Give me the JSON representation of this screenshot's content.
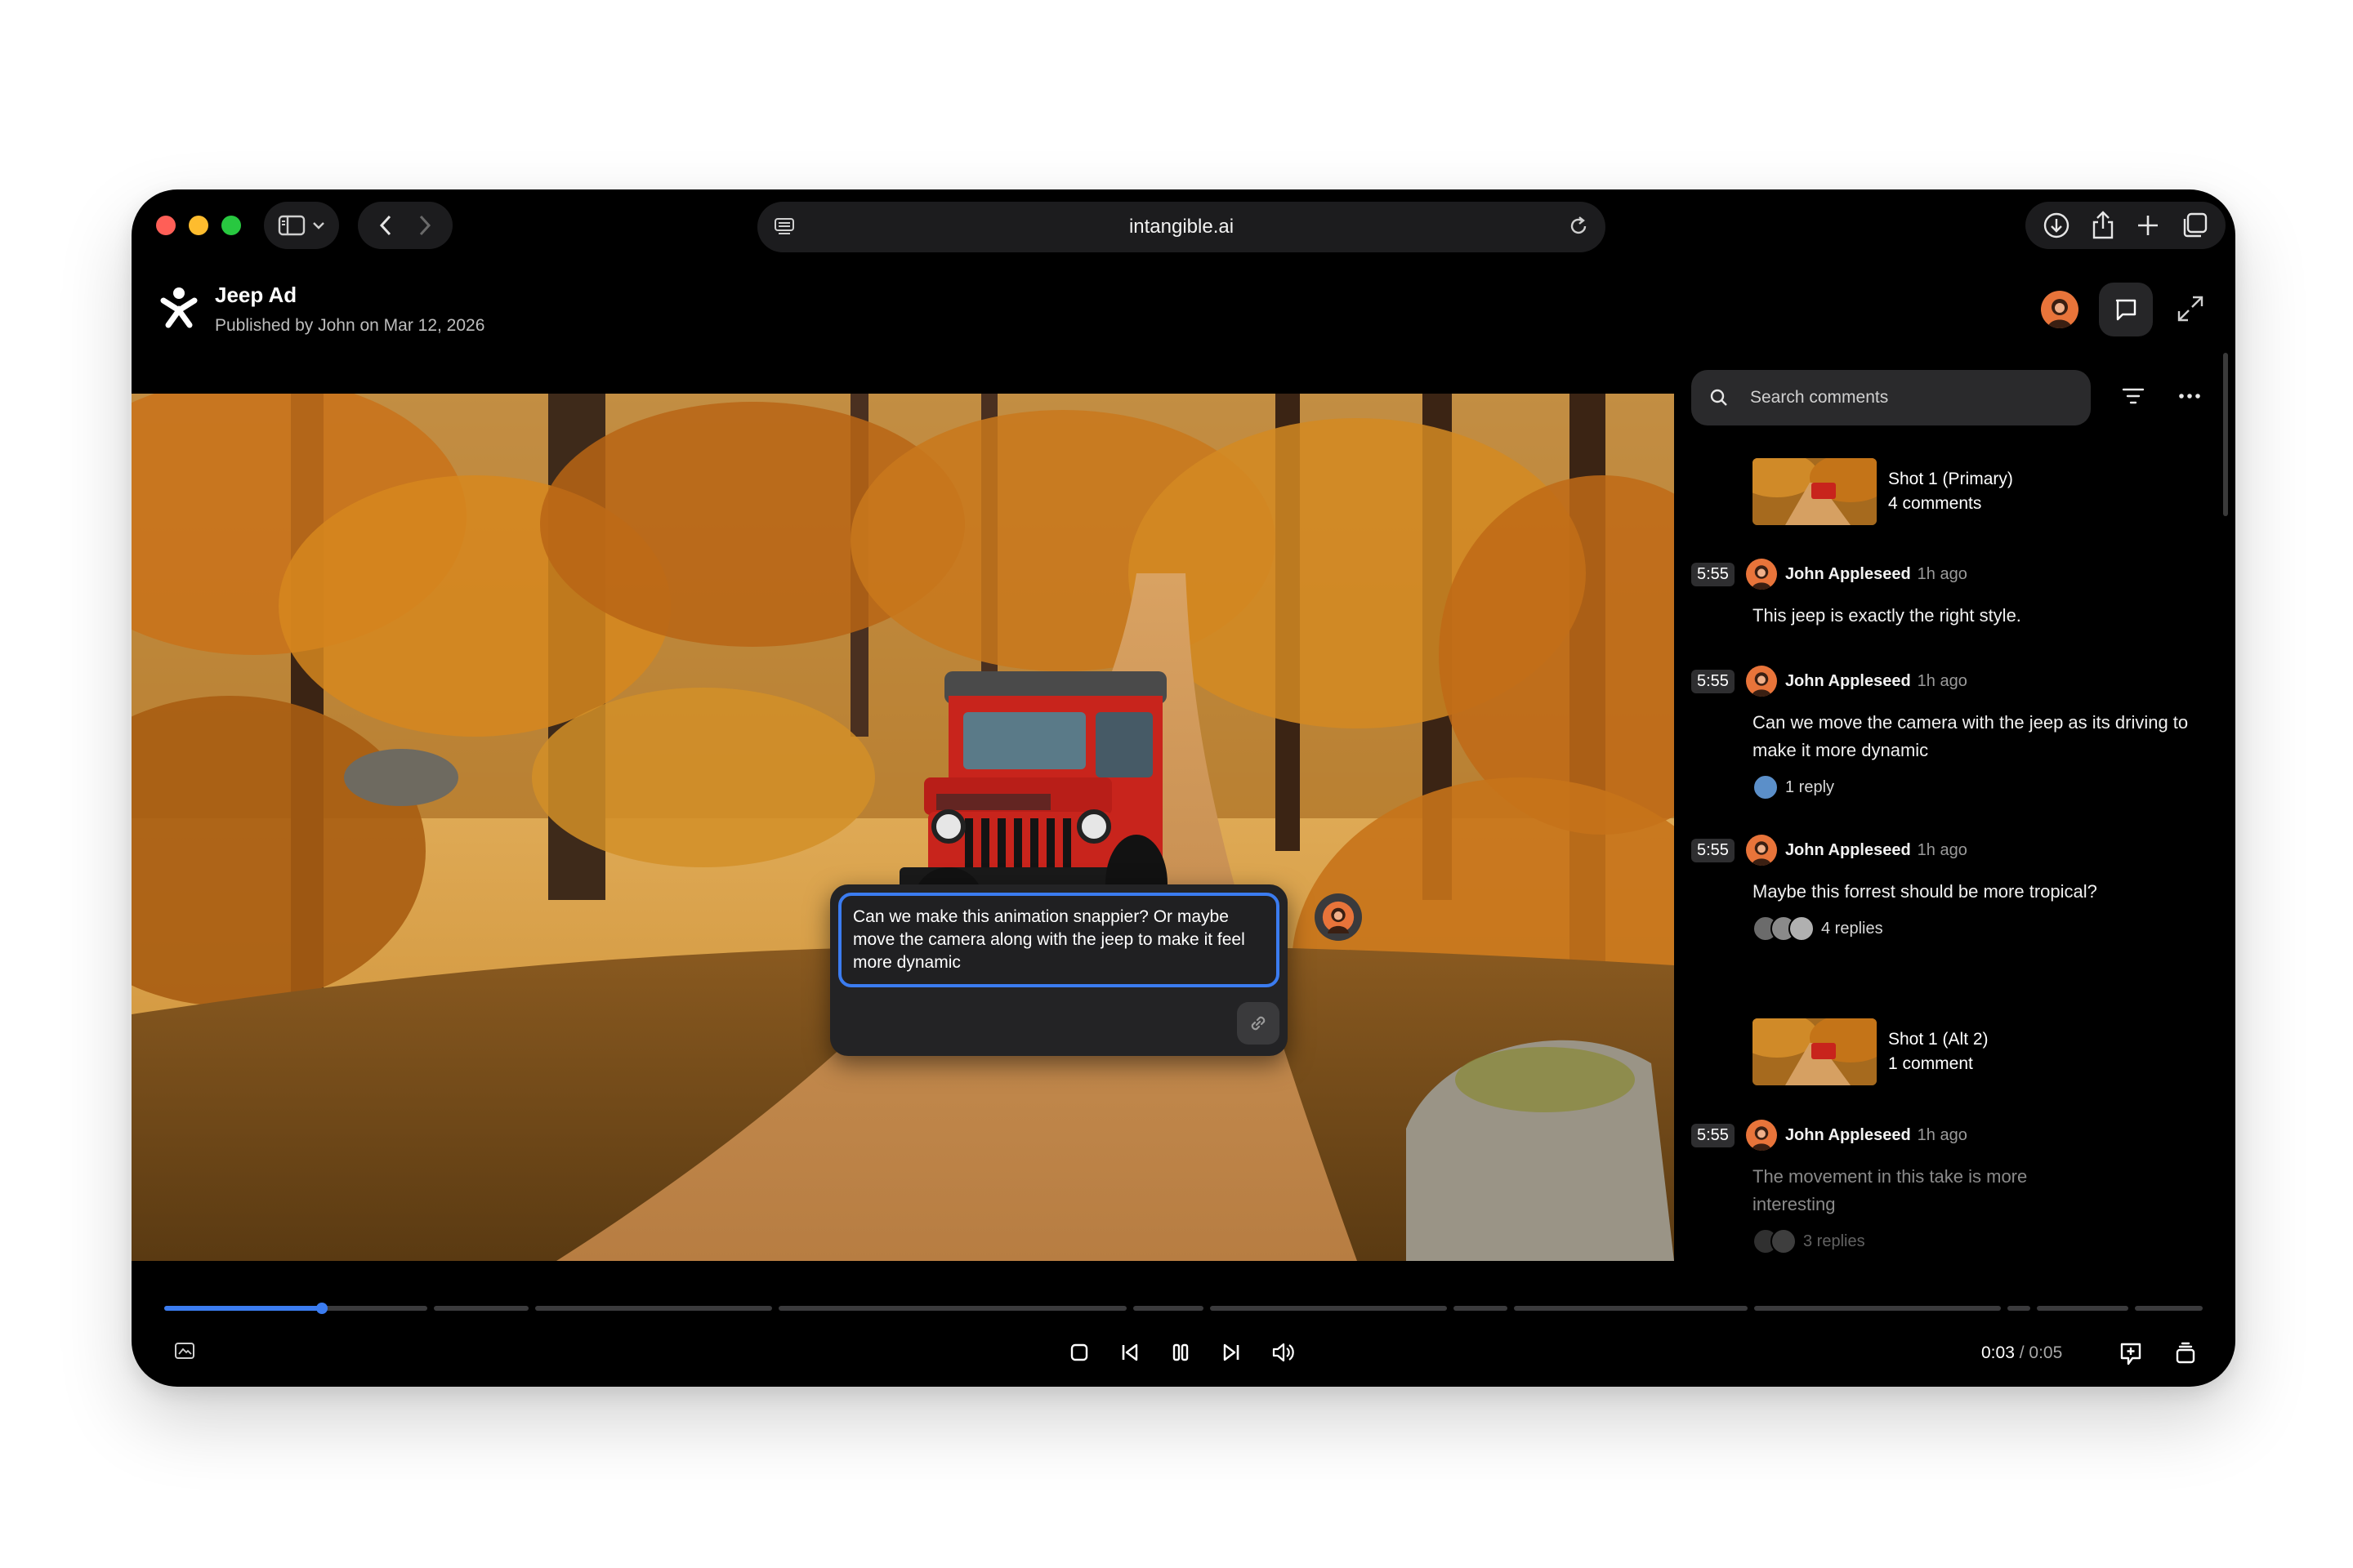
{
  "browser": {
    "url": "intangible.ai",
    "icons": [
      "sidebar-icon",
      "chevron-down-icon",
      "back-icon",
      "forward-icon",
      "reader-icon",
      "reload-icon",
      "download-icon",
      "share-icon",
      "new-tab-icon",
      "tabs-icon"
    ]
  },
  "header": {
    "title": "Jeep Ad",
    "subtitle": "Published by John on Mar 12, 2026"
  },
  "composer": {
    "text": "Can we make this animation snappier? Or maybe move the camera along with the jeep to make it feel more dynamic"
  },
  "comments_panel": {
    "search_placeholder": "Search comments",
    "groups": [
      {
        "shot_name": "Shot 1 (Primary)",
        "shot_count": "4 comments",
        "comments": [
          {
            "ts": "5:55",
            "author": "John Appleseed",
            "ago": "1h ago",
            "text": "This jeep is exactly the right style.",
            "replies": ""
          },
          {
            "ts": "5:55",
            "author": "John Appleseed",
            "ago": "1h ago",
            "text": "Can we move the camera with the jeep as its driving to make it more dynamic",
            "replies": "1 reply"
          },
          {
            "ts": "5:55",
            "author": "John Appleseed",
            "ago": "1h ago",
            "text": "Maybe this forrest should be more tropical?",
            "replies": "4 replies"
          }
        ]
      },
      {
        "shot_name": "Shot 1 (Alt 2)",
        "shot_count": "1 comment",
        "comments": [
          {
            "ts": "5:55",
            "author": "John Appleseed",
            "ago": "1h ago",
            "text": "The movement in this take is more interesting",
            "replies": "3 replies"
          }
        ]
      }
    ]
  },
  "player": {
    "current_time": "0:03",
    "separator": "/",
    "duration": "0:05",
    "progress_fraction": 0.6
  },
  "colors": {
    "accent": "#3b7cf0",
    "avatar": "#e8743a",
    "panel": "#2a2a2c"
  }
}
